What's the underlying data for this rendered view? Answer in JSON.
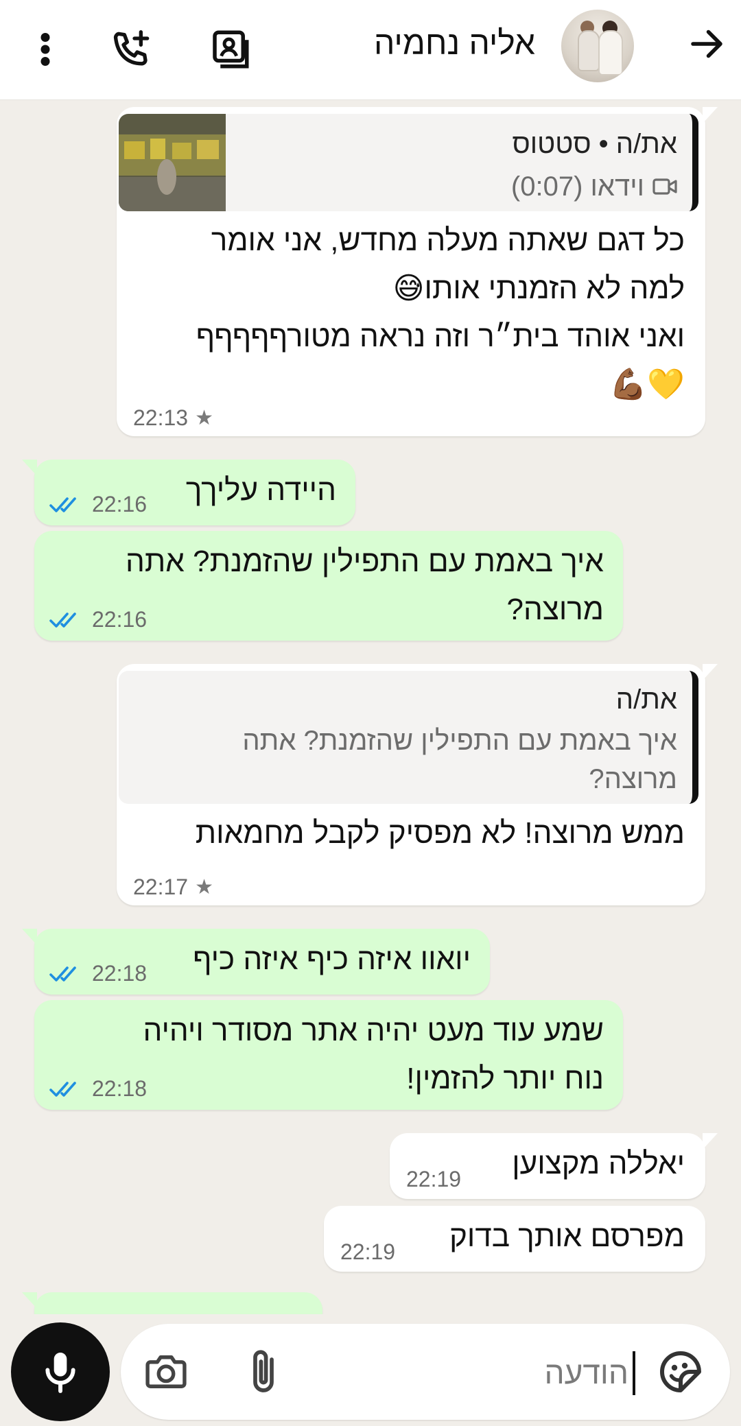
{
  "header": {
    "contact_name": "אליה נחמיה",
    "icons": [
      "arrow-right-icon",
      "avatar",
      "contact-card-icon",
      "add-call-icon",
      "more-vert-icon"
    ]
  },
  "messages": [
    {
      "direction": "in",
      "quote": {
        "author": "את/ה • סטטוס",
        "text": "וידאו (0:07)",
        "icon": "video-icon"
      },
      "text": "כל דגם שאתה מעלה מחדש, אני אומר\nלמה לא הזמנתי אותו😅\nואני אוהד בית״ר וזה נראה מטורףףףףף\n💛💪🏾",
      "time": "22:13",
      "starred": true
    },
    {
      "direction": "out",
      "text": "היידה עליךך",
      "time": "22:16",
      "read": true
    },
    {
      "direction": "out",
      "text": "איך באמת עם התפילין שהזמנת? אתה\nמרוצה?",
      "time": "22:16",
      "read": true
    },
    {
      "direction": "in",
      "quote": {
        "author": "את/ה",
        "text": "איך באמת עם התפילין שהזמנת? אתה\nמרוצה?"
      },
      "text": "ממש מרוצה! לא מפסיק לקבל מחמאות",
      "time": "22:17",
      "starred": true
    },
    {
      "direction": "out",
      "text": "יואוו איזה כיף איזה כיף",
      "time": "22:18",
      "read": true
    },
    {
      "direction": "out",
      "text": "שמע עוד מעט יהיה אתר מסודר ויהיה\nנוח יותר להזמין!",
      "time": "22:18",
      "read": true
    },
    {
      "direction": "in",
      "text": "יאללה מקצוען",
      "time": "22:19"
    },
    {
      "direction": "in",
      "text": "מפרסם אותך בדוק",
      "time": "22:19"
    }
  ],
  "input": {
    "placeholder": "הודעה",
    "icons": [
      "sticker-icon",
      "attach-icon",
      "camera-icon",
      "mic-icon"
    ]
  },
  "colors": {
    "chat_background": "#f1eee9",
    "outgoing_bubble": "#d9fdd3",
    "incoming_bubble": "#ffffff",
    "read_ticks": "#1f8fe0",
    "mic_button": "#101010"
  }
}
